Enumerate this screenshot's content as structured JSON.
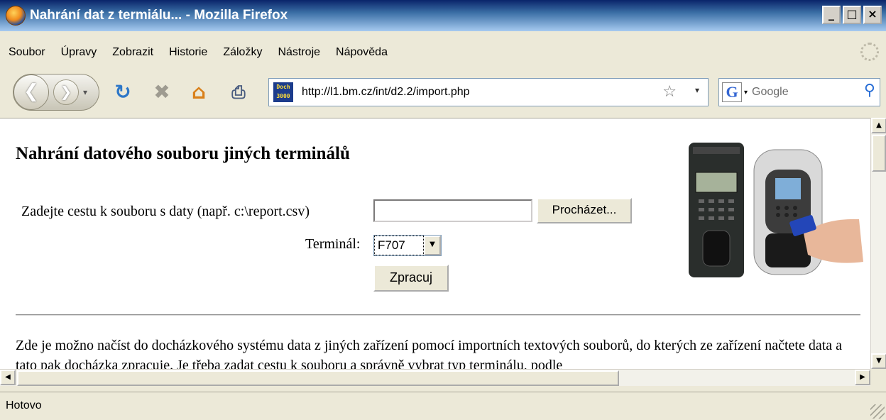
{
  "window": {
    "title": "Nahrání dat z termiálu... - Mozilla Firefox",
    "minimize": "_",
    "maximize": "□",
    "close": "×"
  },
  "menu": [
    "Soubor",
    "Úpravy",
    "Zobrazit",
    "Historie",
    "Záložky",
    "Nástroje",
    "Nápověda"
  ],
  "nav": {
    "url": "http://l1.bm.cz/int/d2.2/import.php",
    "site_icon_text": "Doch 3000",
    "search_placeholder": "Google"
  },
  "page": {
    "heading": "Nahrání datového souboru jiných terminálů",
    "path_label": "Zadejte cestu k souboru s daty (např. c:\\report.csv)",
    "path_value": "",
    "browse_label": "Procházet...",
    "terminal_label": "Terminál:",
    "terminal_value": "F707",
    "submit_label": "Zpracuj",
    "paragraph": "Zde je možno načíst do docházkového systému data z jiných zařízení pomocí importních textových souborů, do kterých ze zařízení načtete data a tato pak docházka zpracuje. Je třeba zadat cestu k souboru a správně vybrat typ terminálu, podle"
  },
  "status": {
    "text": "Hotovo"
  },
  "colors": {
    "titlebar": "#0a246a",
    "chrome": "#ece9d8",
    "content_bg": "#ffffff"
  }
}
